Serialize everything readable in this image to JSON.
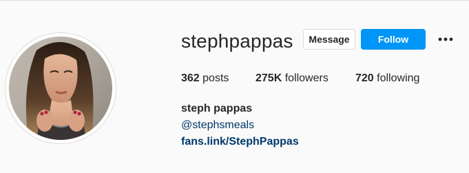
{
  "profile": {
    "username": "stephpappas",
    "full_name": "steph pappas",
    "handle": "@stephsmeals",
    "link": "fans.link/StephPappas",
    "avatar_alt": "profile picture"
  },
  "actions": {
    "message_label": "Message",
    "follow_label": "Follow",
    "more_icon": "ellipsis-icon"
  },
  "stats": {
    "posts_count": "362",
    "posts_label": "posts",
    "followers_count": "275K",
    "followers_label": "followers",
    "following_count": "720",
    "following_label": "following"
  },
  "colors": {
    "accent": "#0095f6",
    "link": "#00376b",
    "text": "#262626",
    "background": "#fafafa",
    "border": "#dbdbdb"
  }
}
